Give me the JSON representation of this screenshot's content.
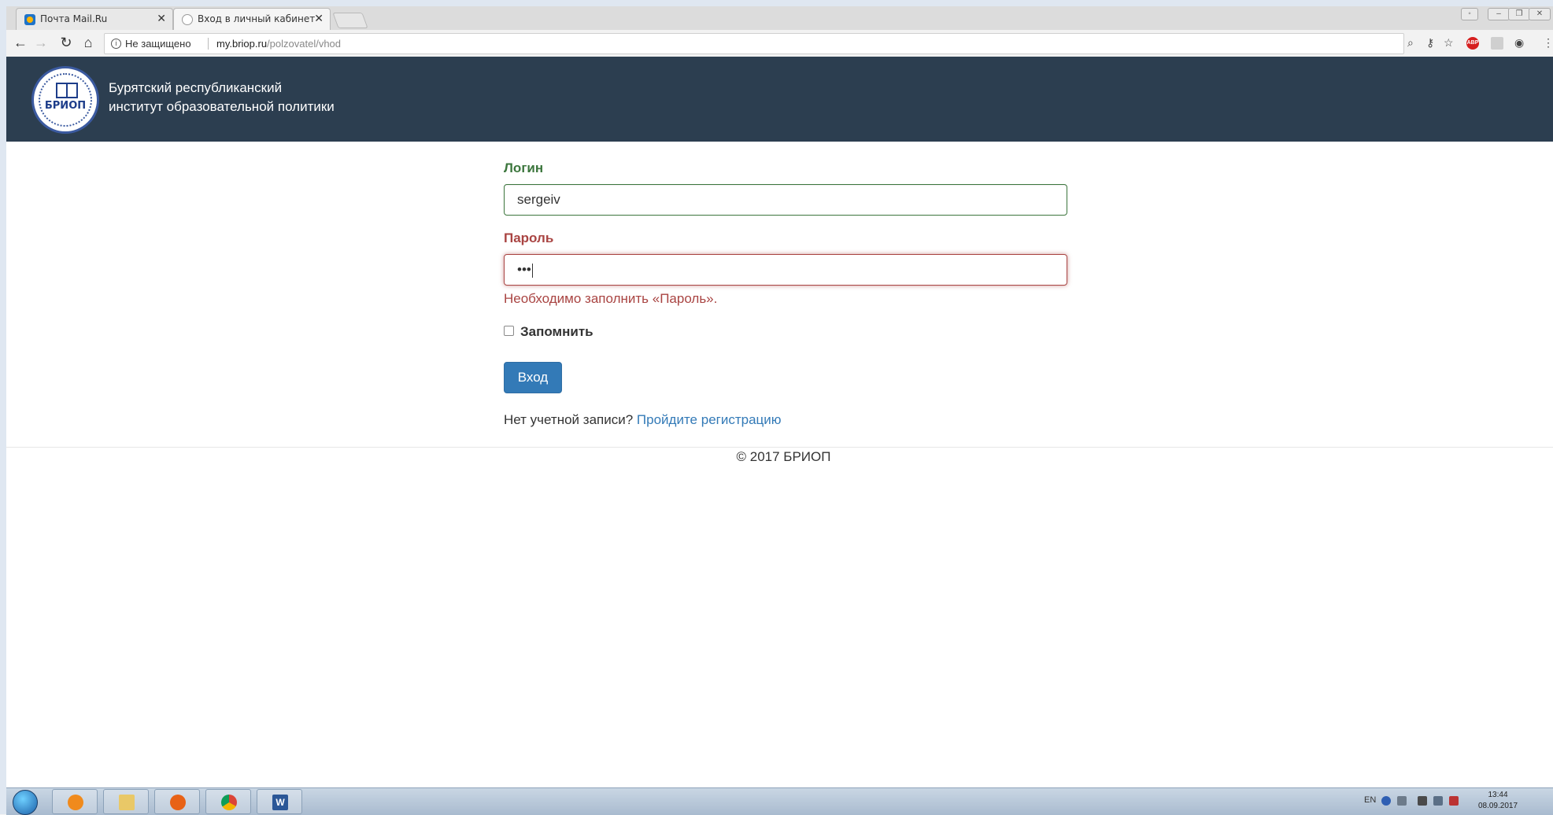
{
  "browser": {
    "tabs": [
      {
        "title": "Почта Mail.Ru"
      },
      {
        "title": "Вход в личный кабинет"
      }
    ],
    "security_text": "Не защищено",
    "url_host": "my.briop.ru",
    "url_path": "/polzovatel/vhod",
    "tab_close_glyph": "✕"
  },
  "site": {
    "logo_text": "БРИОП",
    "org_name_line1": "Бурятский республиканский",
    "org_name_line2": "институт образовательной политики"
  },
  "form": {
    "login_label": "Логин",
    "login_value": "sergeiv",
    "password_label": "Пароль",
    "password_masked": "•••",
    "password_error": "Необходимо заполнить «Пароль».",
    "remember_label": "Запомнить",
    "remember_checked": false,
    "submit_label": "Вход",
    "no_account_text": "Нет учетной записи?",
    "register_link": "Пройдите регистрацию"
  },
  "footer": {
    "copyright": "© 2017 БРИОП"
  },
  "taskbar": {
    "language": "EN",
    "time": "13:44",
    "date": "08.09.2017",
    "word_glyph": "W"
  },
  "colors": {
    "header_bg": "#2c3e50",
    "success": "#3c763d",
    "error": "#a94442",
    "primary": "#337ab7"
  }
}
